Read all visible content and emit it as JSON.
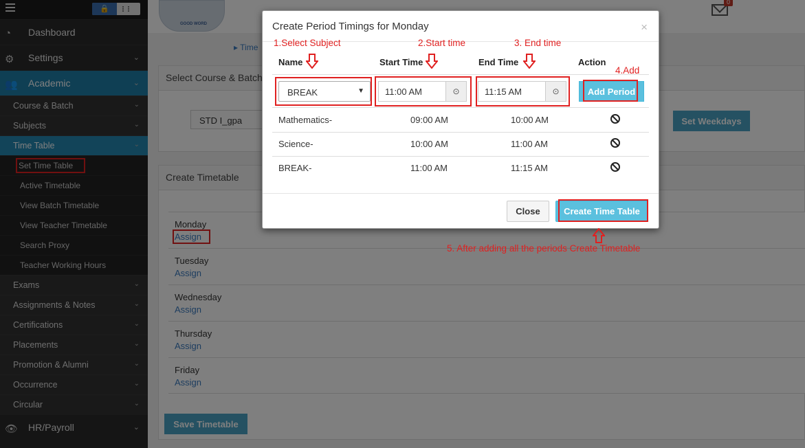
{
  "sidebar": {
    "main_items": [
      {
        "label": "Dashboard",
        "icon": "dashboard-icon"
      },
      {
        "label": "Settings",
        "icon": "gears-icon"
      },
      {
        "label": "Academic",
        "icon": "users-icon"
      },
      {
        "label": "HR/Payroll",
        "icon": "eye-icon"
      }
    ],
    "academic_subitems": [
      "Course & Batch",
      "Subjects",
      "Time Table"
    ],
    "timetable_children": [
      "Set Time Table",
      "Active Timetable",
      "View Batch Timetable",
      "View Teacher Timetable",
      "Search Proxy",
      "Teacher Working Hours"
    ],
    "more_subitems": [
      "Exams",
      "Assignments & Notes",
      "Certifications",
      "Placements",
      "Promotion & Alumni",
      "Occurrence",
      "Circular"
    ]
  },
  "header": {
    "mail_badge": "0"
  },
  "breadcrumb": "Time",
  "course_panel": {
    "title": "Select Course & Batch",
    "selected_batch": "STD I_gpa",
    "set_weekdays_label": "Set Weekdays"
  },
  "timetable_panel": {
    "title": "Create Timetable",
    "days": [
      {
        "day": "Monday",
        "action": "Assign"
      },
      {
        "day": "Tuesday",
        "action": "Assign"
      },
      {
        "day": "Wednesday",
        "action": "Assign"
      },
      {
        "day": "Thursday",
        "action": "Assign"
      },
      {
        "day": "Friday",
        "action": "Assign"
      }
    ],
    "save_label": "Save Timetable"
  },
  "modal": {
    "title": "Create Period Timings for Monday",
    "close_symbol": "×",
    "columns": {
      "name": "Name",
      "start": "Start Time",
      "end": "End Time",
      "action": "Action"
    },
    "new_row": {
      "subject": "BREAK",
      "start": "11:00 AM",
      "end": "11:15 AM",
      "add_label": "Add Period"
    },
    "periods": [
      {
        "name": "Mathematics-",
        "start": "09:00 AM",
        "end": "10:00 AM"
      },
      {
        "name": "Science-",
        "start": "10:00 AM",
        "end": "11:00 AM"
      },
      {
        "name": "BREAK-",
        "start": "11:00 AM",
        "end": "11:15 AM"
      }
    ],
    "close_label": "Close",
    "create_label": "Create Time Table"
  },
  "annotations": {
    "step1": "1.Select Subject",
    "step2": "2.Start time",
    "step3": "3. End time",
    "step4": "4.Add",
    "step5": "5. After adding all the periods  Create Timetable"
  },
  "colors": {
    "sidebar_bg": "#2a2a2a",
    "active_blue": "#1e7fa8",
    "button_info": "#5bc0de",
    "annotation_red": "#e02020"
  }
}
